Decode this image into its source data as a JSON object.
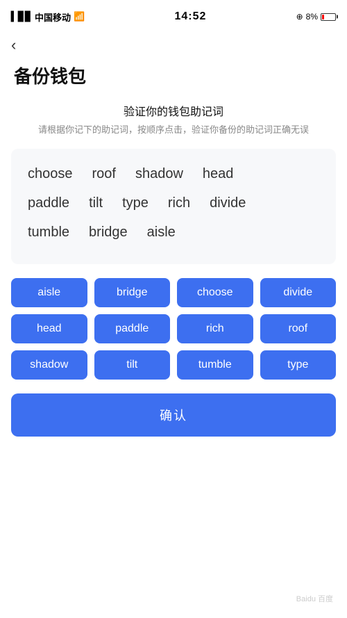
{
  "statusBar": {
    "carrier": "中国移动",
    "time": "14:52",
    "battery": "8%"
  },
  "back": "‹",
  "pageTitle": "备份钱包",
  "verifySection": {
    "heading": "验证你的钱包助记词",
    "desc": "请根据你记下的助记词，按顺序点击，验证你备份的助记词正确无误"
  },
  "displayWords": [
    {
      "word": "choose"
    },
    {
      "word": "roof"
    },
    {
      "word": "shadow"
    },
    {
      "word": "head"
    },
    {
      "word": "paddle"
    },
    {
      "word": "tilt"
    },
    {
      "word": "type"
    },
    {
      "word": "rich"
    },
    {
      "word": "divide"
    },
    {
      "word": "tumble"
    },
    {
      "word": "bridge"
    },
    {
      "word": "aisle"
    }
  ],
  "chips": [
    "aisle",
    "bridge",
    "choose",
    "divide",
    "head",
    "paddle",
    "rich",
    "roof",
    "shadow",
    "tilt",
    "tumble",
    "type"
  ],
  "confirmBtn": "确认"
}
